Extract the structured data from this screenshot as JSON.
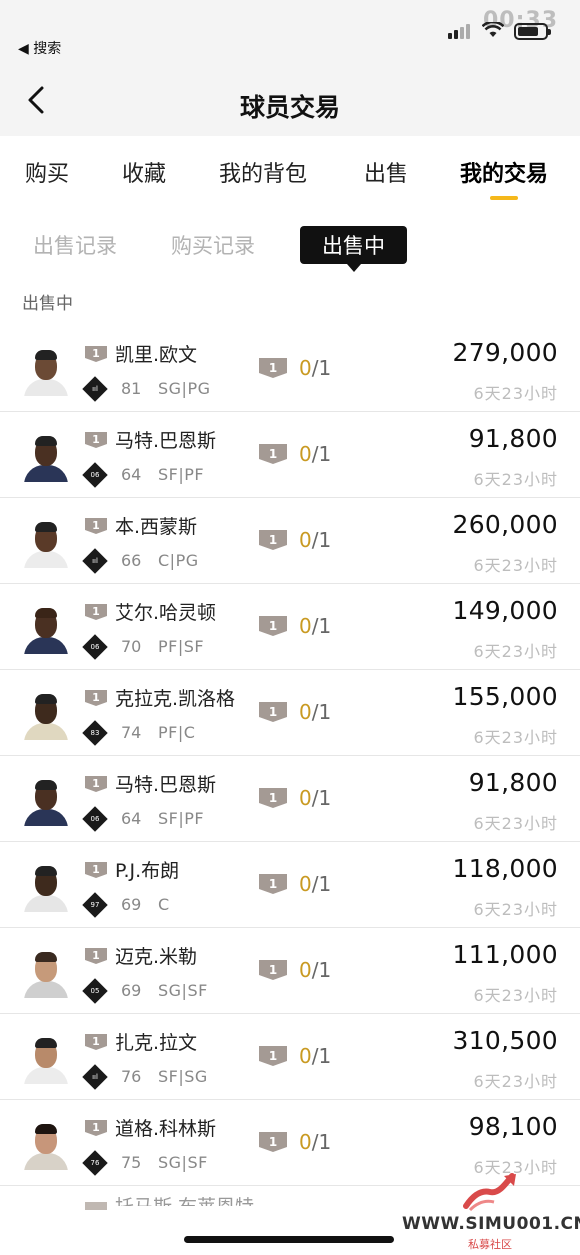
{
  "status": {
    "time": "00:33",
    "back_app": "◀ 搜索"
  },
  "navbar": {
    "title": "球员交易"
  },
  "tabs": [
    "购买",
    "收藏",
    "我的背包",
    "出售",
    "我的交易"
  ],
  "subtabs": [
    "出售记录",
    "购买记录",
    "出售中"
  ],
  "section_label": "出售中",
  "rows": [
    {
      "lvl": "1",
      "name": "凯里.欧文",
      "badge": "ııl",
      "rating": "81",
      "pos": "SG|PG",
      "qlvl": "1",
      "sold": "0",
      "total": "/1",
      "price": "279,000",
      "time": "6天23小时"
    },
    {
      "lvl": "1",
      "name": "马特.巴恩斯",
      "badge": "06",
      "rating": "64",
      "pos": "SF|PF",
      "qlvl": "1",
      "sold": "0",
      "total": "/1",
      "price": "91,800",
      "time": "6天23小时"
    },
    {
      "lvl": "1",
      "name": "本.西蒙斯",
      "badge": "ııl",
      "rating": "66",
      "pos": "C|PG",
      "qlvl": "1",
      "sold": "0",
      "total": "/1",
      "price": "260,000",
      "time": "6天23小时"
    },
    {
      "lvl": "1",
      "name": "艾尔.哈灵顿",
      "badge": "06",
      "rating": "70",
      "pos": "PF|SF",
      "qlvl": "1",
      "sold": "0",
      "total": "/1",
      "price": "149,000",
      "time": "6天23小时"
    },
    {
      "lvl": "1",
      "name": "克拉克.凯洛格",
      "badge": "83",
      "rating": "74",
      "pos": "PF|C",
      "qlvl": "1",
      "sold": "0",
      "total": "/1",
      "price": "155,000",
      "time": "6天23小时"
    },
    {
      "lvl": "1",
      "name": "马特.巴恩斯",
      "badge": "06",
      "rating": "64",
      "pos": "SF|PF",
      "qlvl": "1",
      "sold": "0",
      "total": "/1",
      "price": "91,800",
      "time": "6天23小时"
    },
    {
      "lvl": "1",
      "name": "P.J.布朗",
      "badge": "97",
      "rating": "69",
      "pos": "C",
      "qlvl": "1",
      "sold": "0",
      "total": "/1",
      "price": "118,000",
      "time": "6天23小时"
    },
    {
      "lvl": "1",
      "name": "迈克.米勒",
      "badge": "05",
      "rating": "69",
      "pos": "SG|SF",
      "qlvl": "1",
      "sold": "0",
      "total": "/1",
      "price": "111,000",
      "time": "6天23小时"
    },
    {
      "lvl": "1",
      "name": "扎克.拉文",
      "badge": "ııl",
      "rating": "76",
      "pos": "SF|SG",
      "qlvl": "1",
      "sold": "0",
      "total": "/1",
      "price": "310,500",
      "time": "6天23小时"
    },
    {
      "lvl": "1",
      "name": "道格.科林斯",
      "badge": "76",
      "rating": "75",
      "pos": "SG|SF",
      "qlvl": "1",
      "sold": "0",
      "total": "/1",
      "price": "98,100",
      "time": "6天23小时"
    }
  ],
  "partial_row_name": "托马斯.布莱恩特",
  "watermark": {
    "site": "WWW.SIMU001.CN",
    "sub": "私募社区"
  },
  "colors": {
    "accent": "#f5b81b",
    "sold": "#c99a22",
    "level_badge": "#a49a94"
  }
}
